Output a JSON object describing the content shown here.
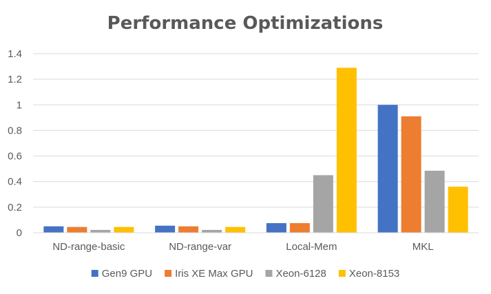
{
  "chart_data": {
    "type": "bar",
    "title": "Performance Optimizations",
    "xlabel": "",
    "ylabel": "",
    "categories": [
      "ND-range-basic",
      "ND-range-var",
      "Local-Mem",
      "MKL"
    ],
    "series": [
      {
        "name": "Gen9 GPU",
        "values": [
          0.05,
          0.055,
          0.075,
          1.0
        ],
        "color": "#4472C4"
      },
      {
        "name": "Iris XE Max GPU",
        "values": [
          0.045,
          0.05,
          0.075,
          0.91
        ],
        "color": "#ED7D31"
      },
      {
        "name": "Xeon-6128",
        "values": [
          0.022,
          0.022,
          0.45,
          0.485
        ],
        "color": "#A5A5A5"
      },
      {
        "name": "Xeon-8153",
        "values": [
          0.045,
          0.045,
          1.29,
          0.36
        ],
        "color": "#FFC000"
      }
    ],
    "ylim": [
      0,
      1.4
    ],
    "yticks": [
      "0",
      "0.2",
      "0.4",
      "0.6",
      "0.8",
      "1",
      "1.2",
      "1.4"
    ],
    "grid": true,
    "legend_position": "bottom"
  }
}
